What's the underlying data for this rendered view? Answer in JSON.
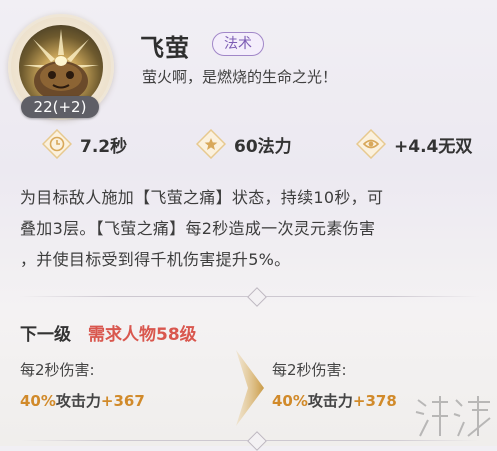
{
  "skill": {
    "name": "飞萤",
    "type_tag": "法术",
    "quote": "萤火啊，是燃烧的生命之光！",
    "level_badge": "22(+2)"
  },
  "stats": {
    "cooldown": "7.2秒",
    "cost": "60法力",
    "musou": "+4.4无双"
  },
  "description": {
    "line1": "为目标敌人施加【飞萤之痛】状态，持续10秒，可",
    "line2": "叠加3层。【飞萤之痛】每2秒造成一次灵元素伤害",
    "line3": "，并使目标受到得千机伤害提升5%。"
  },
  "next_level": {
    "label": "下一级",
    "requirement": "需求人物58级"
  },
  "damage": {
    "current": {
      "label": "每2秒伤害:",
      "percent": "40%",
      "text": "攻击力",
      "add": "+367"
    },
    "next": {
      "label": "每2秒伤害:",
      "percent": "40%",
      "text": "攻击力",
      "add": "+378"
    }
  },
  "colors": {
    "accent_gold": "#d18a2a",
    "requirement_red": "#d9574e",
    "tag_purple": "#7c5cb4"
  },
  "icons": {
    "cooldown": "clock-icon",
    "cost": "star-icon",
    "musou": "eye-icon"
  }
}
